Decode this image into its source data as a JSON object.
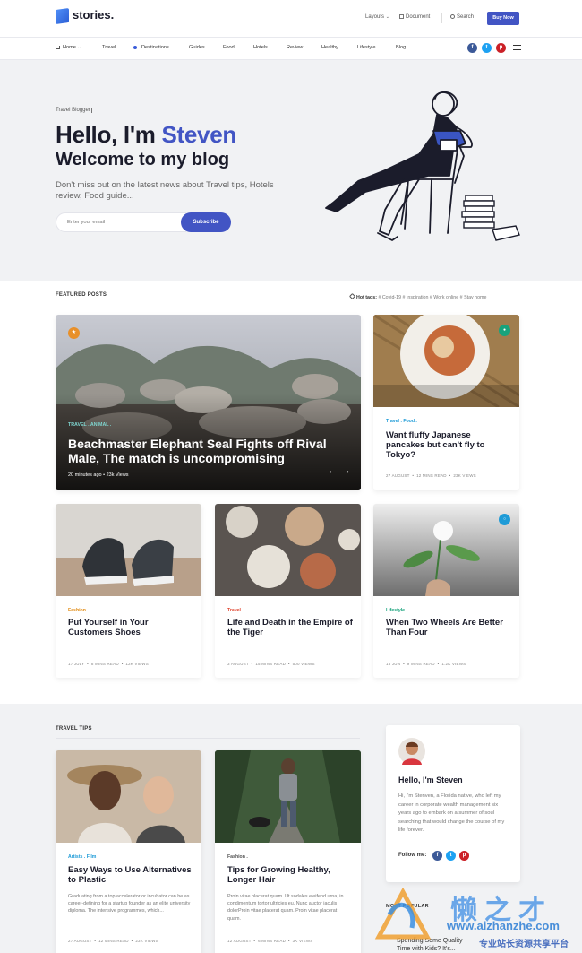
{
  "brand": {
    "name": "stories."
  },
  "topnav": {
    "layouts": "Layouts",
    "document": "Document",
    "search": "Search",
    "buy": "Buy Now"
  },
  "mainnav": {
    "items": [
      "Home",
      "Travel",
      "Destinations",
      "Guides",
      "Food",
      "Hotels",
      "Review",
      "Healthy",
      "Lifestyle",
      "Blog"
    ]
  },
  "social": {
    "facebook": "f",
    "twitter": "t",
    "pinterest": "p"
  },
  "hero": {
    "tag": "Travel Blogger",
    "hello": "Hello, I'm ",
    "name": "Steven",
    "welcome": "Welcome to my blog",
    "subtitle": "Don't miss out on the latest news about Travel tips, Hotels review, Food guide...",
    "email_placeholder": "Enter your email",
    "subscribe": "Subscribe"
  },
  "featured": {
    "title": "FEATURED POSTS",
    "hot_label": "Hot tags:",
    "hot_tags": [
      "# Covid-19",
      "# Inspiration",
      "# Work online",
      "# Stay home"
    ],
    "big": {
      "cats": "TRAVEL .   ANIMAL .",
      "title": "Beachmaster Elephant Seal Fights off Rival Male, The match is uncompromising",
      "time": "20 minutes ago",
      "views": "23k Views"
    },
    "cards": [
      {
        "cats": "Travel .  Food .",
        "title": "Want fluffy Japanese pancakes but can't fly to Tokyo?",
        "date": "27 AUGUST",
        "read": "12 MINS READ",
        "views": "23K VIEWS"
      },
      {
        "cats": "Fashion .",
        "title": "Put Yourself in Your Customers Shoes",
        "date": "17 JULY",
        "read": "8 MINS READ",
        "views": "12K VIEWS"
      },
      {
        "cats": "Travel .",
        "title": "Life and Death in the Empire of the Tiger",
        "date": "3 AUGUST",
        "read": "15 MINS READ",
        "views": "500 VIEWS"
      },
      {
        "cats": "Lifestyle .",
        "title": "When Two Wheels Are Better Than Four",
        "date": "15 JUN",
        "read": "9 MINS READ",
        "views": "1.2K VIEWS"
      }
    ]
  },
  "tips": {
    "title": "TRAVEL TIPS",
    "cards": [
      {
        "cats": "Artists .   Film .",
        "title": "Easy Ways to Use Alternatives to Plastic",
        "excerpt": "Graduating from a top accelerator or incubator can be as career-defining for a startup founder as an elite university diploma. The intensive programmes, which...",
        "date": "27 AUGUST",
        "read": "12 MINS READ",
        "views": "23K VIEWS"
      },
      {
        "cats": "Fashion .",
        "title": "Tips for Growing Healthy, Longer Hair",
        "excerpt": "Proin vitae placerat quam. Ut sodales eleifend urna, in condimentum tortor ultricies eu. Nunc auctor iaculis dolorProin vitae placerat quam. Proin vitae placerat quam.",
        "date": "12 AUGUST",
        "read": "6 MINS READ",
        "views": "3K VIEWS"
      }
    ]
  },
  "author": {
    "hello": "Hello, I'm Steven",
    "bio": "Hi, I'm Stenven, a Florida native, who left my career in corporate wealth management six years ago to embark on a summer of soul searching that would change the course of my life forever.",
    "follow": "Follow me:"
  },
  "popular": {
    "title": "MOST POPULAR",
    "item": "Spending Some Quality Time with Kids? It's..."
  },
  "watermark": {
    "brand": "懒之才",
    "url": "www.aizhanzhe.com",
    "tagline": "专业站长资源共享平台"
  },
  "colors": {
    "accent": "#4255c4",
    "facebook": "#3b5998",
    "twitter": "#1da1f2",
    "pinterest": "#cb2027",
    "fashion": "#e28b13",
    "travel": "#e0452f",
    "lifestyle": "#18a37c"
  }
}
